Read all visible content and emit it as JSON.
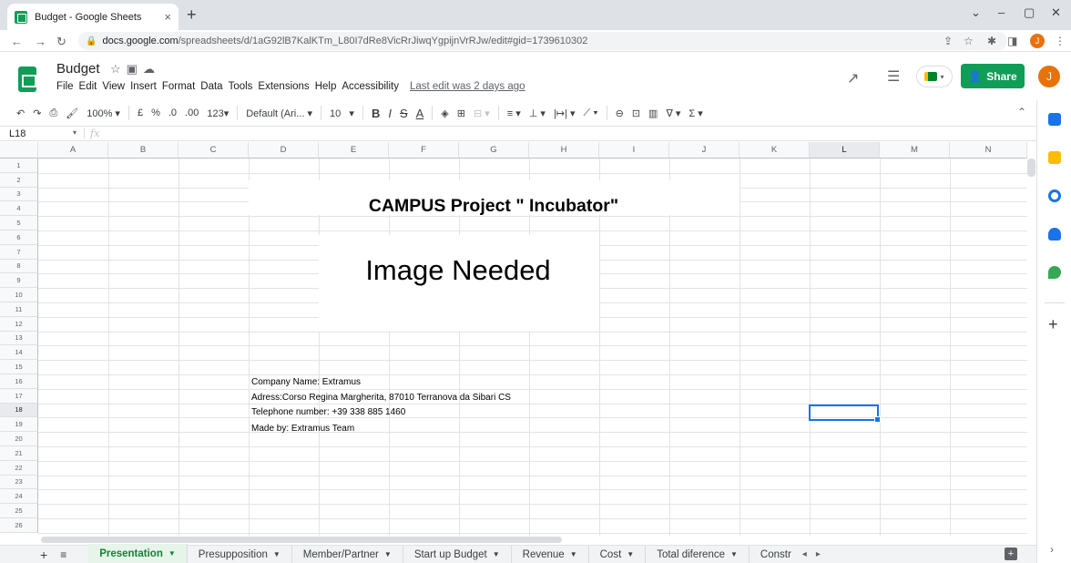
{
  "browser": {
    "tab_title": "Budget - Google Sheets",
    "tab_close": "×",
    "new_tab": "+",
    "url_host": "docs.google.com",
    "url_path": "/spreadsheets/d/1aG92lB7KalKTm_L80I7dRe8VicRrJiwqYgpijnVrRJw/edit#gid=1739610302",
    "profile_initial": "J"
  },
  "doc": {
    "title": "Budget",
    "menu": [
      "File",
      "Edit",
      "View",
      "Insert",
      "Format",
      "Data",
      "Tools",
      "Extensions",
      "Help",
      "Accessibility"
    ],
    "last_edit": "Last edit was 2 days ago",
    "share_label": "Share",
    "user_initial": "J"
  },
  "toolbar": {
    "zoom": "100%",
    "currency": "£",
    "percent": "%",
    "dec_decrease": ".0",
    "dec_increase": ".00",
    "format_more": "123",
    "font": "Default (Ari...",
    "font_size": "10"
  },
  "formula_bar": {
    "name_box": "L18",
    "fx": "fx"
  },
  "grid": {
    "columns": [
      "A",
      "B",
      "C",
      "D",
      "E",
      "F",
      "G",
      "H",
      "I",
      "J",
      "K",
      "L",
      "M",
      "N"
    ],
    "rows": [
      "1",
      "2",
      "3",
      "4",
      "5",
      "6",
      "7",
      "8",
      "9",
      "10",
      "11",
      "12",
      "13",
      "14",
      "15",
      "16",
      "17",
      "18",
      "19",
      "20",
      "21",
      "22",
      "23",
      "24",
      "25",
      "26"
    ],
    "selected_column": "L",
    "selected_row": "18"
  },
  "content": {
    "title": "CAMPUS Project \" Incubator\"",
    "image_placeholder": "Image Needed",
    "company_name": "Company Name: Extramus",
    "address": "Adress:Corso Regina Margherita, 87010 Terranova da Sibari CS",
    "telephone": "Telephone number: +39 338 885 1460",
    "made_by": "Made by: Extramus Team"
  },
  "sheets": {
    "tabs": [
      "Presentation",
      "Presupposition",
      "Member/Partner",
      "Start up Budget",
      "Revenue",
      "Cost",
      "Total diference",
      "Constr"
    ],
    "active": "Presentation"
  },
  "colors": {
    "sheets_green": "#0f9d58",
    "selection_blue": "#1a73e8",
    "active_tab_green": "#188038"
  }
}
